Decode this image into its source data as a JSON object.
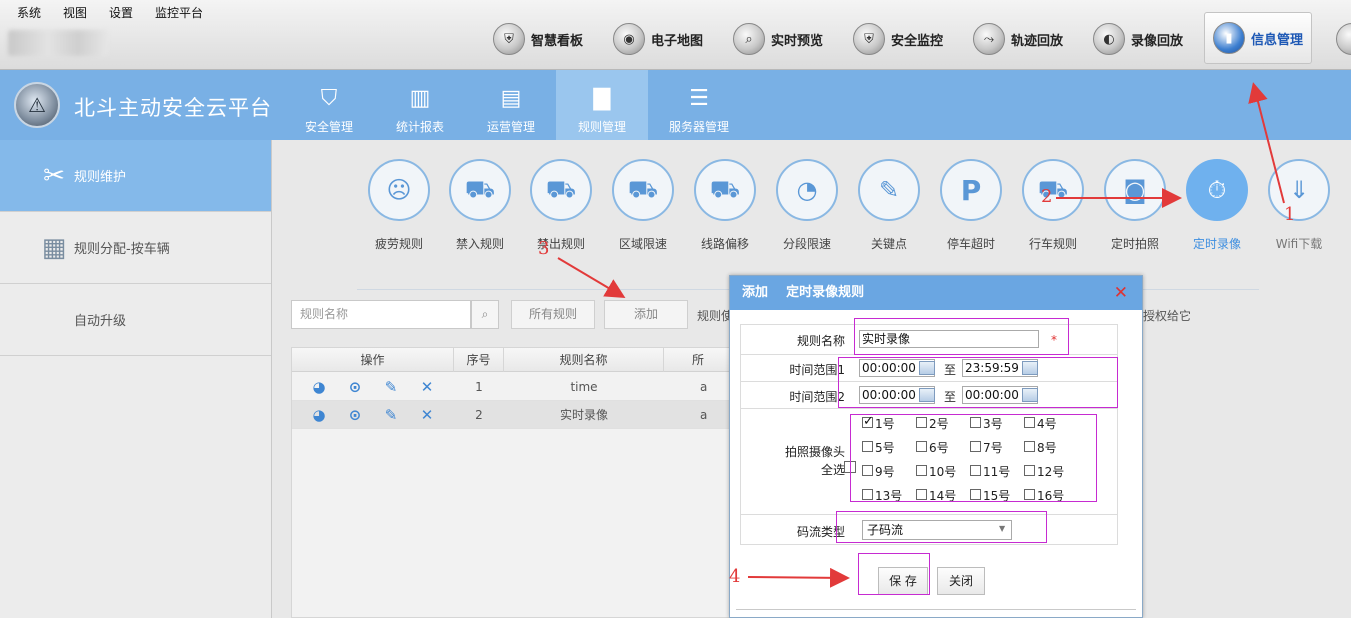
{
  "menubar": [
    "系统",
    "视图",
    "设置",
    "监控平台"
  ],
  "topnav": [
    {
      "label": "智慧看板",
      "icon": "shield-icon",
      "glyph": "⛨"
    },
    {
      "label": "电子地图",
      "icon": "map-icon",
      "glyph": "◉"
    },
    {
      "label": "实时预览",
      "icon": "search-icon",
      "glyph": "⌕"
    },
    {
      "label": "安全监控",
      "icon": "shield-check-icon",
      "glyph": "⛨"
    },
    {
      "label": "轨迹回放",
      "icon": "track-icon",
      "glyph": "⤳"
    },
    {
      "label": "录像回放",
      "icon": "video-icon",
      "glyph": "◐"
    },
    {
      "label": "信息管理",
      "icon": "chart-icon",
      "glyph": "▮"
    }
  ],
  "brand": {
    "title": "北斗主动安全云平台"
  },
  "headnav": [
    {
      "label": "安全管理",
      "icon": "shield-outline-icon",
      "glyph": "⛉"
    },
    {
      "label": "统计报表",
      "icon": "bar-chart-icon",
      "glyph": "▥"
    },
    {
      "label": "运营管理",
      "icon": "operations-icon",
      "glyph": "▤"
    },
    {
      "label": "规则管理",
      "icon": "rules-icon",
      "glyph": "▇"
    },
    {
      "label": "服务器管理",
      "icon": "sliders-icon",
      "glyph": "☰"
    }
  ],
  "sidebar": [
    {
      "label": "规则维护",
      "icon": "tools-icon",
      "glyph": "✂"
    },
    {
      "label": "规则分配-按车辆",
      "icon": "clipboard-bus-icon",
      "glyph": "▦"
    },
    {
      "label": "自动升级",
      "icon": "",
      "glyph": ""
    }
  ],
  "rules": [
    {
      "label": "疲劳规则",
      "icon": "fatigue-icon",
      "glyph": "☹"
    },
    {
      "label": "禁入规则",
      "icon": "no-entry-car-icon",
      "glyph": "⛟"
    },
    {
      "label": "禁出规则",
      "icon": "no-exit-car-icon",
      "glyph": "⛟"
    },
    {
      "label": "区域限速",
      "icon": "area-speed-icon",
      "glyph": "⛟"
    },
    {
      "label": "线路偏移",
      "icon": "route-offset-icon",
      "glyph": "⛟"
    },
    {
      "label": "分段限速",
      "icon": "speedometer-icon",
      "glyph": "◔"
    },
    {
      "label": "关键点",
      "icon": "edit-point-icon",
      "glyph": "✎"
    },
    {
      "label": "停车超时",
      "icon": "parking-icon",
      "glyph": "P"
    },
    {
      "label": "行车规则",
      "icon": "driving-rule-icon",
      "glyph": "⛟"
    },
    {
      "label": "定时拍照",
      "icon": "camera-icon",
      "glyph": "◙"
    },
    {
      "label": "定时录像",
      "icon": "timer-video-icon",
      "glyph": "⏱"
    },
    {
      "label": "Wifi下载",
      "icon": "wifi-download-icon",
      "glyph": "⇓"
    }
  ],
  "toolbar": {
    "search_placeholder": "规则名称",
    "all_rules": "所有规则",
    "add": "添加",
    "link_left": "规则使",
    "link_right": "授权给它"
  },
  "grid": {
    "headers": [
      "操作",
      "序号",
      "规则名称",
      "所"
    ],
    "rows": [
      {
        "index": "1",
        "name": "time",
        "extra": "a"
      },
      {
        "index": "2",
        "name": "实时录像",
        "extra": "a"
      }
    ]
  },
  "dialog": {
    "title": "添加    定时录像规则",
    "name_label": "规则名称",
    "name_value": "实时录像",
    "required_mark": "*",
    "range1_label": "时间范围1",
    "range1_start": "00:00:00",
    "range1_end": "23:59:59",
    "range2_label": "时间范围2",
    "range2_start": "00:00:00",
    "range2_end": "00:00:00",
    "to": "至",
    "camera_label": "拍照摄像头",
    "select_all": "全选",
    "cameras": [
      {
        "label": "1号",
        "checked": true
      },
      {
        "label": "2号",
        "checked": false
      },
      {
        "label": "3号",
        "checked": false
      },
      {
        "label": "4号",
        "checked": false
      },
      {
        "label": "5号",
        "checked": false
      },
      {
        "label": "6号",
        "checked": false
      },
      {
        "label": "7号",
        "checked": false
      },
      {
        "label": "8号",
        "checked": false
      },
      {
        "label": "9号",
        "checked": false
      },
      {
        "label": "10号",
        "checked": false
      },
      {
        "label": "11号",
        "checked": false
      },
      {
        "label": "12号",
        "checked": false
      },
      {
        "label": "13号",
        "checked": false
      },
      {
        "label": "14号",
        "checked": false
      },
      {
        "label": "15号",
        "checked": false
      },
      {
        "label": "16号",
        "checked": false
      }
    ],
    "stream_label": "码流类型",
    "stream_value": "子码流",
    "save": "保 存",
    "close": "关闭",
    "close_icon": "✕"
  },
  "annotations": [
    "1",
    "2",
    "3",
    "4"
  ],
  "colors": {
    "accent": "#79b0e5",
    "annotation": "#e23a3a",
    "highlight_box": "#c62bd1"
  }
}
